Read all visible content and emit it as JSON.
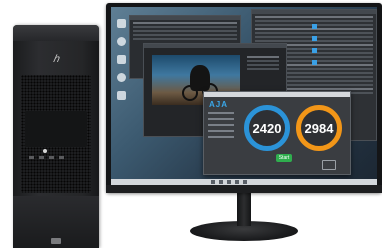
{
  "aja_system_test": {
    "logo": "AJA",
    "write_result": "2420",
    "read_result": "2984",
    "start_button": "Start"
  },
  "colors": {
    "write_gauge": "#2b93d8",
    "read_gauge": "#f29618",
    "start_button": "#2fae4e",
    "aja_logo": "#3aa7e8"
  },
  "icons": {
    "tower": "workstation-tower-icon",
    "monitor": "monitor-icon",
    "desktop_icons": [
      "desktop-icon",
      "desktop-icon",
      "desktop-icon",
      "desktop-icon",
      "desktop-icon"
    ]
  }
}
